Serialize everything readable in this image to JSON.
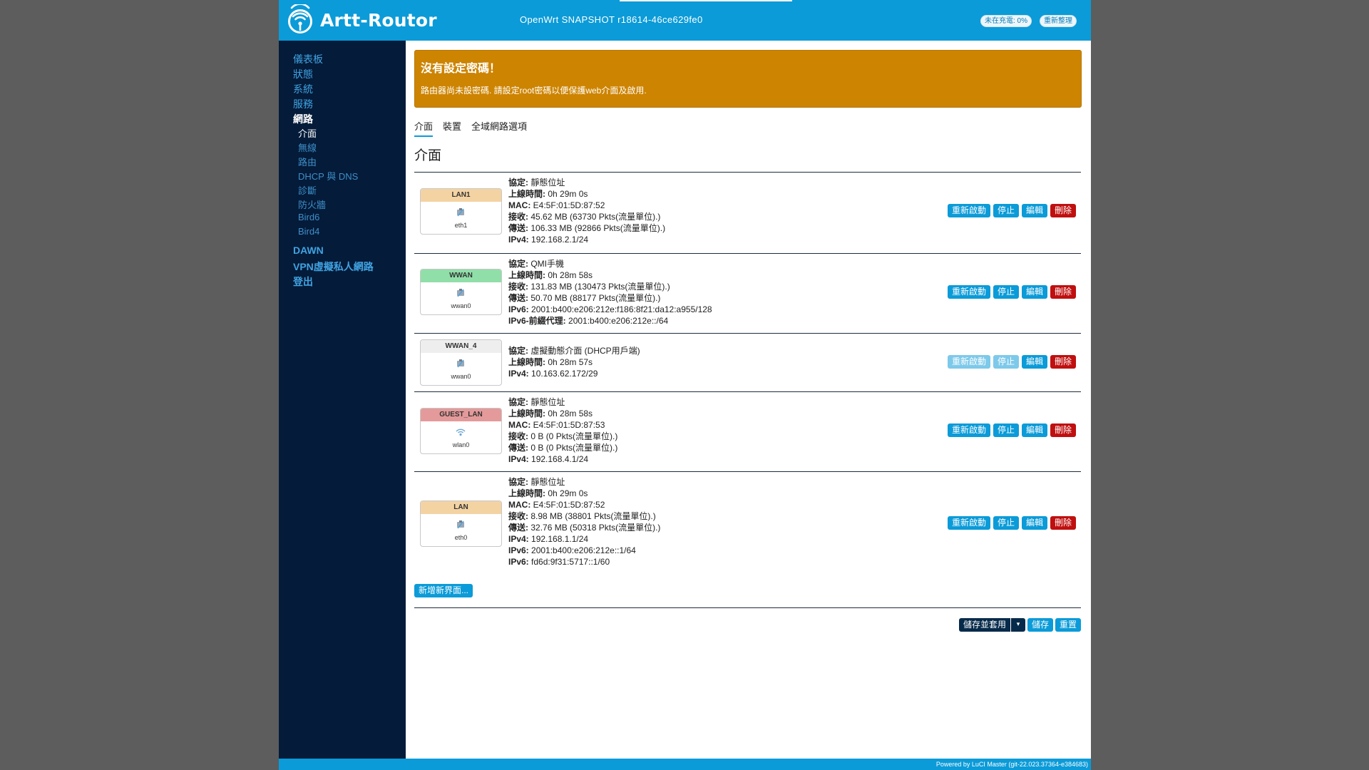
{
  "header": {
    "brand": "Artt-Routor",
    "version": "OpenWrt SNAPSHOT r18614-46ce629fe0",
    "charge_badge": "未在充電: 0%",
    "refresh_badge": "重新整理"
  },
  "sidebar": {
    "items": [
      {
        "label": "儀表板"
      },
      {
        "label": "狀態"
      },
      {
        "label": "系統"
      },
      {
        "label": "服務"
      },
      {
        "label": "網路"
      }
    ],
    "sub_items": [
      {
        "label": "介面"
      },
      {
        "label": "無線"
      },
      {
        "label": "路由"
      },
      {
        "label": "DHCP 與 DNS"
      },
      {
        "label": "診斷"
      },
      {
        "label": "防火牆"
      },
      {
        "label": "Bird6"
      },
      {
        "label": "Bird4"
      }
    ],
    "bottom_items": [
      {
        "label": "DAWN"
      },
      {
        "label": "VPN虛擬私人網路"
      },
      {
        "label": "登出"
      }
    ]
  },
  "alert": {
    "title": "沒有設定密碼！",
    "text": "路由器尚未設密碼. 請設定root密碼以便保護web介面及啟用."
  },
  "tabs": [
    {
      "label": "介面"
    },
    {
      "label": "裝置"
    },
    {
      "label": "全域網路選項"
    }
  ],
  "page_title": "介面",
  "interfaces": [
    {
      "name": "LAN1",
      "device": "eth1",
      "color": "#f4d3a3",
      "lines": [
        {
          "k": "協定:",
          "v": "靜態位址"
        },
        {
          "k": "上線時間:",
          "v": "0h 29m 0s"
        },
        {
          "k": "MAC:",
          "v": "E4:5F:01:5D:87:52"
        },
        {
          "k": "接收:",
          "v": "45.62 MB (63730 Pkts(流量單位).)"
        },
        {
          "k": "傳送:",
          "v": "106.33 MB (92866 Pkts(流量單位).)"
        },
        {
          "k": "IPv4:",
          "v": "192.168.2.1/24"
        }
      ]
    },
    {
      "name": "WWAN",
      "device": "wwan0",
      "color": "#90dfa9",
      "lines": [
        {
          "k": "協定:",
          "v": "QMI手機"
        },
        {
          "k": "上線時間:",
          "v": "0h 28m 58s"
        },
        {
          "k": "接收:",
          "v": "131.83 MB (130473 Pkts(流量單位).)"
        },
        {
          "k": "傳送:",
          "v": "50.70 MB (88177 Pkts(流量單位).)"
        },
        {
          "k": "IPv6:",
          "v": "2001:b400:e206:212e:f186:8f21:da12:a955/128"
        },
        {
          "k": "IPv6-前綴代理:",
          "v": "2001:b400:e206:212e::/64"
        }
      ]
    },
    {
      "name": "WWAN_4",
      "device": "wwan0",
      "color": "#eeeeee",
      "lines": [
        {
          "k": "協定:",
          "v": "虛擬動態介面 (DHCP用戶端)"
        },
        {
          "k": "上線時間:",
          "v": "0h 28m 57s"
        },
        {
          "k": "IPv4:",
          "v": "10.163.62.172/29"
        }
      ]
    },
    {
      "name": "GUEST_LAN",
      "device": "wlan0",
      "color": "#e49a9a",
      "lines": [
        {
          "k": "協定:",
          "v": "靜態位址"
        },
        {
          "k": "上線時間:",
          "v": "0h 28m 58s"
        },
        {
          "k": "MAC:",
          "v": "E4:5F:01:5D:87:53"
        },
        {
          "k": "接收:",
          "v": "0 B (0 Pkts(流量單位).)"
        },
        {
          "k": "傳送:",
          "v": "0 B (0 Pkts(流量單位).)"
        },
        {
          "k": "IPv4:",
          "v": "192.168.4.1/24"
        }
      ]
    },
    {
      "name": "LAN",
      "device": "eth0",
      "color": "#f4d3a3",
      "lines": [
        {
          "k": "協定:",
          "v": "靜態位址"
        },
        {
          "k": "上線時間:",
          "v": "0h 29m 0s"
        },
        {
          "k": "MAC:",
          "v": "E4:5F:01:5D:87:52"
        },
        {
          "k": "接收:",
          "v": "8.98 MB (38801 Pkts(流量單位).)"
        },
        {
          "k": "傳送:",
          "v": "32.76 MB (50318 Pkts(流量單位).)"
        },
        {
          "k": "IPv4:",
          "v": "192.168.1.1/24"
        },
        {
          "k": "IPv6:",
          "v": "2001:b400:e206:212e::1/64"
        },
        {
          "k": "IPv6:",
          "v": "fd6d:9f31:5717::1/60"
        }
      ]
    }
  ],
  "row_actions": {
    "restart": "重新啟動",
    "stop": "停止",
    "edit": "編輯",
    "delete": "刪除"
  },
  "add_button": "新增新界面...",
  "bottom_actions": {
    "save_apply": "儲存並套用",
    "save": "儲存",
    "reset": "重置"
  },
  "footer": "Powered by LuCI Master (git-22.023.37364-e384683)",
  "colors": {
    "header_bg": "#0b9bd8",
    "sidebar_bg": "#041b3a",
    "alert_bg": "#cd8400",
    "delete_btn": "#c00f0f"
  }
}
